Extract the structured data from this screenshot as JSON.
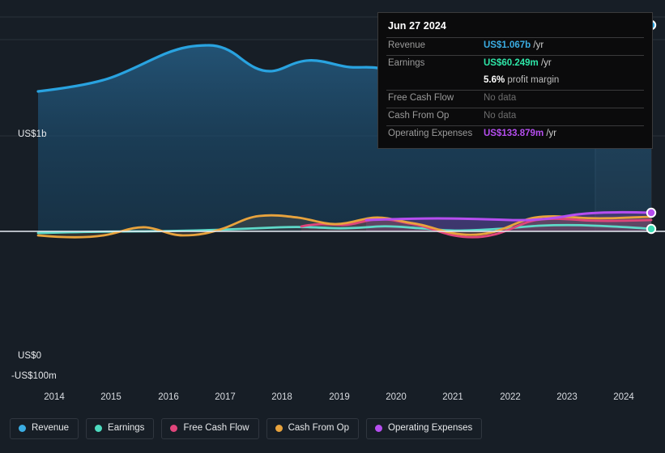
{
  "tooltip": {
    "title": "Jun 27 2024",
    "rows": [
      {
        "key": "Revenue",
        "value": "US$1.067b",
        "unit": " /yr",
        "color": "#3bade3",
        "nodata": false
      },
      {
        "key": "Earnings",
        "value": "US$60.249m",
        "unit": " /yr",
        "color": "#2ee6a8",
        "nodata": false
      },
      {
        "key": "",
        "value": "5.6%",
        "unit": " profit margin",
        "color": "#ffffff",
        "nodata": false
      },
      {
        "key": "Free Cash Flow",
        "value": "No data",
        "unit": "",
        "color": "#6d6d6d",
        "nodata": true
      },
      {
        "key": "Cash From Op",
        "value": "No data",
        "unit": "",
        "color": "#6d6d6d",
        "nodata": true
      },
      {
        "key": "Operating Expenses",
        "value": "US$133.879m",
        "unit": " /yr",
        "color": "#b64ef0",
        "nodata": false
      }
    ]
  },
  "axis": {
    "y_labels": [
      "US$1b",
      "US$0",
      "-US$100m"
    ],
    "y_top": "US$1b",
    "y_zero": "US$0",
    "y_bottom": "-US$100m",
    "x_ticks": [
      "2014",
      "2015",
      "2016",
      "2017",
      "2018",
      "2019",
      "2020",
      "2021",
      "2022",
      "2023",
      "2024"
    ]
  },
  "legend": [
    {
      "label": "Revenue",
      "color": "#3bade3"
    },
    {
      "label": "Earnings",
      "color": "#4ddbbf"
    },
    {
      "label": "Free Cash Flow",
      "color": "#e0457b"
    },
    {
      "label": "Cash From Op",
      "color": "#e8a33d"
    },
    {
      "label": "Operating Expenses",
      "color": "#b64ef0"
    }
  ],
  "chart_data": {
    "type": "area",
    "title": "",
    "xlabel": "",
    "ylabel": "",
    "ylim": [
      -100000000,
      1100000000
    ],
    "y_gridlines": [
      "US$1b",
      "US$0",
      "-US$100m"
    ],
    "grid": true,
    "legend_position": "bottom",
    "x_range": [
      "2013-09",
      "2024-06"
    ],
    "highlight_band": {
      "from": "2023-06",
      "to": "2024-06"
    },
    "series": [
      {
        "name": "Revenue",
        "color": "#3bade3",
        "unit": "US$",
        "points": [
          {
            "x": "2013-09",
            "y": 620
          },
          {
            "x": "2014-03",
            "y": 648
          },
          {
            "x": "2014-09",
            "y": 690
          },
          {
            "x": "2015-03",
            "y": 742
          },
          {
            "x": "2015-09",
            "y": 790
          },
          {
            "x": "2016-03",
            "y": 828
          },
          {
            "x": "2016-09",
            "y": 855
          },
          {
            "x": "2017-03",
            "y": 872
          },
          {
            "x": "2017-09",
            "y": 872
          },
          {
            "x": "2018-03",
            "y": 826
          },
          {
            "x": "2018-09",
            "y": 802
          },
          {
            "x": "2019-03",
            "y": 818
          },
          {
            "x": "2019-09",
            "y": 826
          },
          {
            "x": "2020-03",
            "y": 812
          },
          {
            "x": "2020-09",
            "y": 792
          },
          {
            "x": "2021-03",
            "y": 800
          },
          {
            "x": "2021-09",
            "y": 828
          },
          {
            "x": "2022-03",
            "y": 868
          },
          {
            "x": "2022-09",
            "y": 930
          },
          {
            "x": "2023-03",
            "y": 970
          },
          {
            "x": "2023-09",
            "y": 948
          },
          {
            "x": "2024-03",
            "y": 1020
          },
          {
            "x": "2024-06",
            "y": 1067
          }
        ],
        "end_value": "US$1.067b"
      },
      {
        "name": "Earnings",
        "color": "#4ddbbf",
        "unit": "US$",
        "points": [
          {
            "x": "2013-09",
            "y": 8
          },
          {
            "x": "2015-00",
            "y": 10
          },
          {
            "x": "2016-06",
            "y": 14
          },
          {
            "x": "2018-00",
            "y": 14
          },
          {
            "x": "2019-06",
            "y": 20
          },
          {
            "x": "2020-06",
            "y": 26
          },
          {
            "x": "2021-06",
            "y": 28
          },
          {
            "x": "2022-06",
            "y": 22
          },
          {
            "x": "2023-06",
            "y": 42
          },
          {
            "x": "2024-06",
            "y": 60.249
          }
        ],
        "end_value": "US$60.249m"
      },
      {
        "name": "Free Cash Flow",
        "color": "#e0457b",
        "unit": "US$",
        "starts_at": "2018-06",
        "points": [
          {
            "x": "2018-06",
            "y": 22
          },
          {
            "x": "2019-00",
            "y": 16
          },
          {
            "x": "2019-06",
            "y": 36
          },
          {
            "x": "2020-00",
            "y": 30
          },
          {
            "x": "2020-06",
            "y": 22
          },
          {
            "x": "2021-06",
            "y": 14
          },
          {
            "x": "2022-00",
            "y": -14
          },
          {
            "x": "2022-06",
            "y": -10
          },
          {
            "x": "2023-00",
            "y": 40
          },
          {
            "x": "2023-06",
            "y": 46
          },
          {
            "x": "2024-00",
            "y": 50
          }
        ],
        "end_value": "No data"
      },
      {
        "name": "Cash From Op",
        "color": "#e8a33d",
        "unit": "US$",
        "points": [
          {
            "x": "2013-09",
            "y": -10
          },
          {
            "x": "2014-06",
            "y": -14
          },
          {
            "x": "2015-06",
            "y": 6
          },
          {
            "x": "2016-00",
            "y": -6
          },
          {
            "x": "2016-09",
            "y": -2
          },
          {
            "x": "2017-06",
            "y": 28
          },
          {
            "x": "2018-00",
            "y": 42
          },
          {
            "x": "2018-06",
            "y": 30
          },
          {
            "x": "2019-00",
            "y": 26
          },
          {
            "x": "2019-06",
            "y": 46
          },
          {
            "x": "2020-06",
            "y": 40
          },
          {
            "x": "2021-06",
            "y": 26
          },
          {
            "x": "2022-00",
            "y": 2
          },
          {
            "x": "2022-09",
            "y": 44
          },
          {
            "x": "2023-06",
            "y": 52
          },
          {
            "x": "2024-00",
            "y": 58
          }
        ],
        "end_value": "No data"
      },
      {
        "name": "Operating Expenses",
        "color": "#b64ef0",
        "unit": "US$",
        "starts_at": "2019-06",
        "points": [
          {
            "x": "2019-06",
            "y": 58
          },
          {
            "x": "2020-06",
            "y": 62
          },
          {
            "x": "2021-06",
            "y": 64
          },
          {
            "x": "2022-06",
            "y": 62
          },
          {
            "x": "2023-00",
            "y": 76
          },
          {
            "x": "2023-06",
            "y": 84
          },
          {
            "x": "2024-06",
            "y": 133.879
          }
        ],
        "end_value": "US$133.879m"
      }
    ]
  }
}
